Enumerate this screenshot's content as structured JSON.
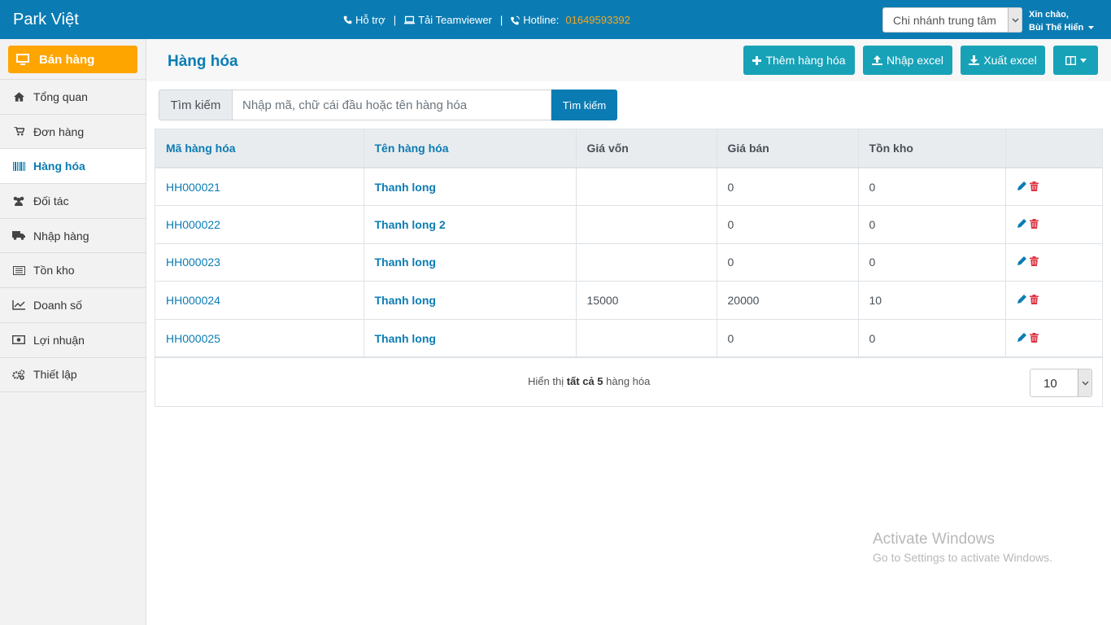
{
  "topbar": {
    "brand": "Park Việt",
    "support_label": "Hỗ trợ",
    "teamviewer_label": "Tải Teamviewer",
    "separator": "|",
    "hotline_label": "Hotline:",
    "hotline_number": "01649593392",
    "branch_selected": "Chi nhánh trung tâm",
    "greeting": "Xin chào,",
    "user_name": "Bùi Thế Hiển"
  },
  "sidebar": {
    "sell_button": "Bán hàng",
    "items": [
      {
        "label": "Tổng quan",
        "icon": "home-icon"
      },
      {
        "label": "Đơn hàng",
        "icon": "cart-icon"
      },
      {
        "label": "Hàng hóa",
        "icon": "barcode-icon",
        "active": true
      },
      {
        "label": "Đối tác",
        "icon": "users-icon"
      },
      {
        "label": "Nhập hàng",
        "icon": "truck-icon"
      },
      {
        "label": "Tồn kho",
        "icon": "list-icon"
      },
      {
        "label": "Doanh số",
        "icon": "line-chart-icon"
      },
      {
        "label": "Lợi nhuận",
        "icon": "money-icon"
      },
      {
        "label": "Thiết lập",
        "icon": "cogs-icon"
      }
    ]
  },
  "header": {
    "title": "Hàng hóa",
    "add_button": "Thêm hàng hóa",
    "import_button": "Nhập excel",
    "export_button": "Xuất excel"
  },
  "search": {
    "label": "Tìm kiếm",
    "placeholder": "Nhập mã, chữ cái đầu hoặc tên hàng hóa",
    "button": "Tìm kiếm"
  },
  "table": {
    "columns": [
      "Mã hàng hóa",
      "Tên hàng hóa",
      "Giá vốn",
      "Giá bán",
      "Tồn kho",
      ""
    ],
    "rows": [
      {
        "code": "HH000021",
        "name": "Thanh long",
        "cost": "",
        "price": "0",
        "stock": "0"
      },
      {
        "code": "HH000022",
        "name": "Thanh long 2",
        "cost": "",
        "price": "0",
        "stock": "0"
      },
      {
        "code": "HH000023",
        "name": "Thanh long",
        "cost": "",
        "price": "0",
        "stock": "0"
      },
      {
        "code": "HH000024",
        "name": "Thanh long",
        "cost": "15000",
        "price": "20000",
        "stock": "10"
      },
      {
        "code": "HH000025",
        "name": "Thanh long",
        "cost": "",
        "price": "0",
        "stock": "0"
      }
    ]
  },
  "footer": {
    "summary_prefix": "Hiển thị",
    "summary_bold": "tất cả 5",
    "summary_suffix": "hàng hóa",
    "page_size": "10"
  },
  "watermark": {
    "line1": "Activate Windows",
    "line2": "Go to Settings to activate Windows."
  },
  "colors": {
    "primary": "#0b7cb3",
    "orange": "#ffa500",
    "teal": "#17a2b8",
    "hotline": "#f5a623",
    "delete": "#dc3545"
  }
}
